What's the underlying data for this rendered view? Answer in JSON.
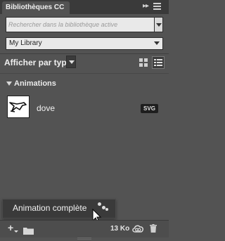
{
  "panel": {
    "title": "Bibliothèques CC",
    "collapse_icon": "double-chevron-right",
    "menu_icon": "hamburger-menu"
  },
  "search": {
    "placeholder": "Rechercher dans la bibliothèque active"
  },
  "library": {
    "selected": "My Library"
  },
  "view": {
    "label": "Afficher par type",
    "mode": "list",
    "grid_icon": "grid-view",
    "list_icon": "list-view"
  },
  "section": {
    "title": "Animations",
    "expanded": true
  },
  "assets": [
    {
      "name": "dove",
      "badge": "SVG",
      "thumbnail_icon": "dove-bird"
    }
  ],
  "popup": {
    "label": "Animation complète",
    "icon": "loading-dots"
  },
  "footer": {
    "size": "13 Ko",
    "add_icon": "plus",
    "folder_icon": "folder",
    "sync_icon": "creative-cloud-sync",
    "trash_icon": "trash"
  },
  "colors": {
    "panel_bg": "#535353",
    "titlebar_bg": "#3a3a3a",
    "field_bg": "#e9e9e9",
    "badge_bg": "#1e1e1e"
  }
}
